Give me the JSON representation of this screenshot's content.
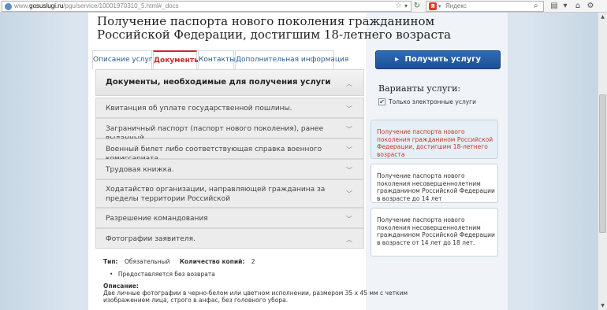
{
  "browser": {
    "url_gray": "www.",
    "url_domain": "gosuslugi.ru",
    "url_rest": "/pgu/service/10001970310_5.html#_docs",
    "search_placeholder": "Яндекс",
    "search_logo": "Я"
  },
  "page": {
    "title": "Получение паспорта нового поколения гражданином Российской Федерации, достигшим 18-летнего возраста"
  },
  "tabs": [
    {
      "label": "Описание услуги",
      "active": false
    },
    {
      "label": "Документы",
      "active": true
    },
    {
      "label": "Контакты",
      "active": false
    },
    {
      "label": "Дополнительная информация",
      "active": false
    }
  ],
  "documents": {
    "heading": "Документы, необходимые для получения услуги",
    "items": [
      {
        "label": "Квитанция об уплате государственной пошлины."
      },
      {
        "label": "Заграничный паспорт (паспорт нового поколения), ранее выданный."
      },
      {
        "label": "Военный билет либо соответствующая справка военного комиссариата."
      },
      {
        "label": "Трудовая книжка."
      },
      {
        "label": "Ходатайство организации, направляющей гражданина за пределы территории Российской"
      },
      {
        "label": "Разрешение командования"
      },
      {
        "label": "Фотографии заявителя."
      }
    ],
    "details": {
      "type_label": "Тип:",
      "type_value": "Обязательный",
      "count_label": "Количество копий:",
      "count_value": "2",
      "bullet": "Предоставляется без возврата",
      "desc_label": "Описание:",
      "desc_line1": "Две личные фотографии в черно-белом или цветном исполнении, размером 35 х 45 мм с четким",
      "desc_line2": "изображением лица, строго в анфас, без головного убора."
    }
  },
  "sidebar": {
    "get_service_label": "Получить услугу",
    "variants_title": "Варианты услуги:",
    "checkbox_label": "Только электронные услуги",
    "checkbox_checked": true,
    "variants": [
      {
        "text": "Получение паспорта нового поколения гражданином Российской Федерации, достигшим 18-летнего возраста",
        "selected": true
      },
      {
        "text": "Получение паспорта нового поколения несовершеннолетним гражданином Российской Федерации в возрасте до 14 лет",
        "selected": false
      },
      {
        "text": "Получение паспорта нового поколения несовершеннолетним гражданином Российской Федерации в возрасте от 14 лет до 18 лет.",
        "selected": false
      }
    ]
  },
  "icons": {
    "tab_active_color": "#c92a2a",
    "button_color": "#1d4f92"
  }
}
